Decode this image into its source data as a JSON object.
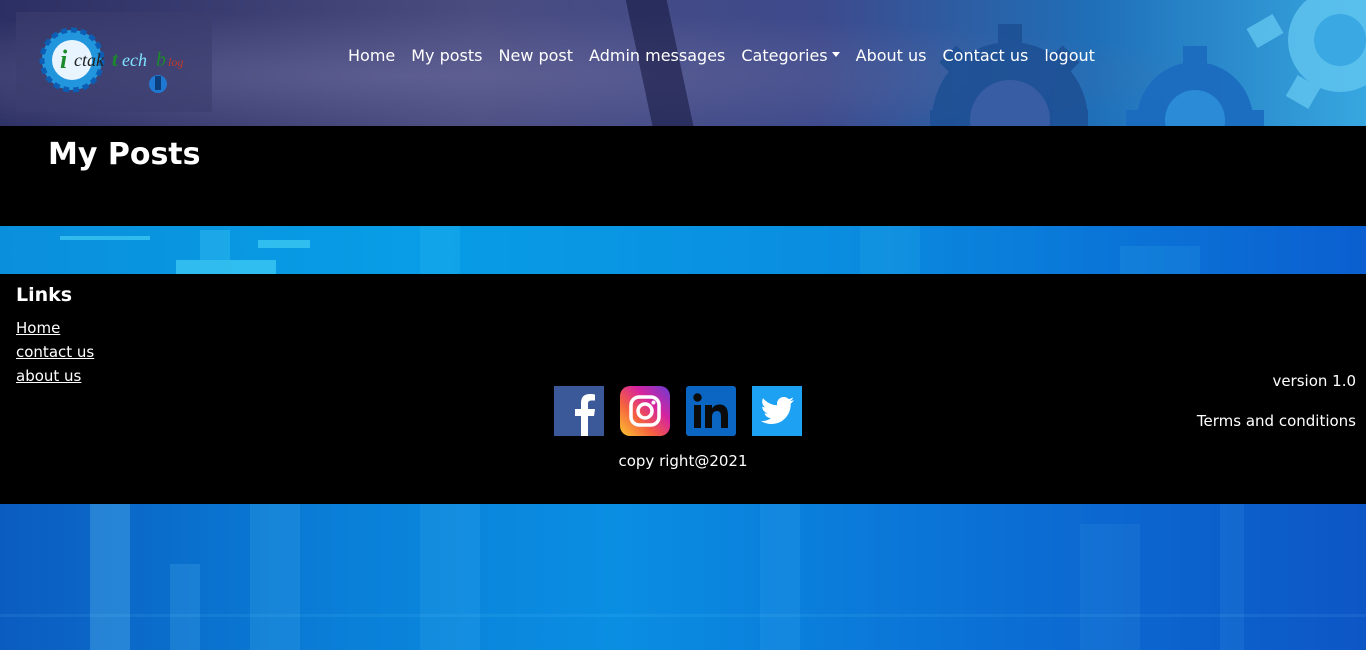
{
  "header": {
    "logo_text": "ictaktech blog",
    "nav": {
      "home": "Home",
      "my_posts": "My posts",
      "new_post": "New post",
      "admin_messages": "Admin messages",
      "categories": "Categories",
      "about_us": "About us",
      "contact_us": "Contact us",
      "logout": "logout"
    }
  },
  "main": {
    "page_title": "My Posts"
  },
  "footer": {
    "links_title": "Links",
    "links": [
      "Home",
      "contact us",
      "about us"
    ],
    "social_icons": [
      "facebook-icon",
      "instagram-icon",
      "linkedin-icon",
      "twitter-icon"
    ],
    "copyright": "copy right@2021",
    "version": "version 1.0",
    "terms": "Terms and conditions"
  },
  "colors": {
    "facebook": "#3b5998",
    "linkedin": "#0a66c2",
    "twitter": "#1da1f2"
  }
}
